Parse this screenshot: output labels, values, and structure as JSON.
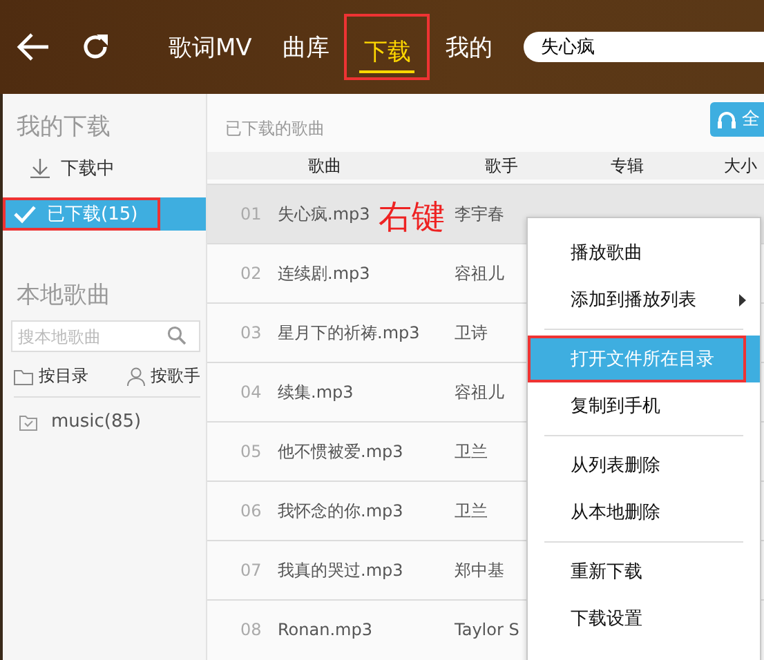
{
  "toolbar": {
    "tabs": [
      {
        "label": "歌词MV",
        "selected": false,
        "annotated": false
      },
      {
        "label": "曲库",
        "selected": false,
        "annotated": false
      },
      {
        "label": "下载",
        "selected": true,
        "annotated": true
      },
      {
        "label": "我的",
        "selected": false,
        "annotated": false
      }
    ],
    "search": {
      "value": "失心疯"
    }
  },
  "sidebar": {
    "download_heading": "我的下载",
    "download_items": [
      {
        "label": "下载中",
        "kind": "downloading",
        "selected": false,
        "annotated": false
      },
      {
        "label": "已下载(15)",
        "kind": "downloaded",
        "selected": true,
        "annotated": true
      }
    ],
    "local_heading": "本地歌曲",
    "search": {
      "placeholder": "搜本地歌曲"
    },
    "filters": [
      {
        "label": "按目录",
        "kind": "folder"
      },
      {
        "label": "按歌手",
        "kind": "person"
      }
    ],
    "folders": [
      {
        "label": "music(85)"
      }
    ]
  },
  "content": {
    "title": "已下载的歌曲",
    "play_all_button": "全",
    "columns": [
      "歌曲",
      "歌手",
      "专辑",
      "大小"
    ],
    "annotation": "右键",
    "rows": [
      {
        "number": "01",
        "song": "失心疯.mp3",
        "artist": "李宇春",
        "selected": true
      },
      {
        "number": "02",
        "song": "连续剧.mp3",
        "artist": "容祖儿",
        "selected": false
      },
      {
        "number": "03",
        "song": "星月下的祈祷.mp3",
        "artist": "卫诗",
        "selected": false
      },
      {
        "number": "04",
        "song": "续集.mp3",
        "artist": "容祖儿",
        "selected": false
      },
      {
        "number": "05",
        "song": "他不惯被爱.mp3",
        "artist": "卫兰",
        "selected": false
      },
      {
        "number": "06",
        "song": "我怀念的你.mp3",
        "artist": "卫兰",
        "selected": false
      },
      {
        "number": "07",
        "song": "我真的哭过.mp3",
        "artist": "郑中基",
        "selected": false
      },
      {
        "number": "08",
        "song": "Ronan.mp3",
        "artist": "Taylor S",
        "selected": false
      }
    ]
  },
  "context_menu": {
    "items": [
      {
        "kind": "item",
        "label": "播放歌曲",
        "selected": false,
        "annotated": false
      },
      {
        "kind": "submenu",
        "label": "添加到播放列表",
        "selected": false,
        "annotated": false
      },
      {
        "kind": "separator"
      },
      {
        "kind": "item",
        "label": "打开文件所在目录",
        "selected": true,
        "annotated": true
      },
      {
        "kind": "item",
        "label": "复制到手机",
        "selected": false,
        "annotated": false
      },
      {
        "kind": "separator"
      },
      {
        "kind": "item",
        "label": "从列表删除",
        "selected": false,
        "annotated": false
      },
      {
        "kind": "item",
        "label": "从本地删除",
        "selected": false,
        "annotated": false
      },
      {
        "kind": "separator"
      },
      {
        "kind": "item",
        "label": "重新下载",
        "selected": false,
        "annotated": false
      },
      {
        "kind": "item",
        "label": "下载设置",
        "selected": false,
        "annotated": false
      }
    ]
  }
}
